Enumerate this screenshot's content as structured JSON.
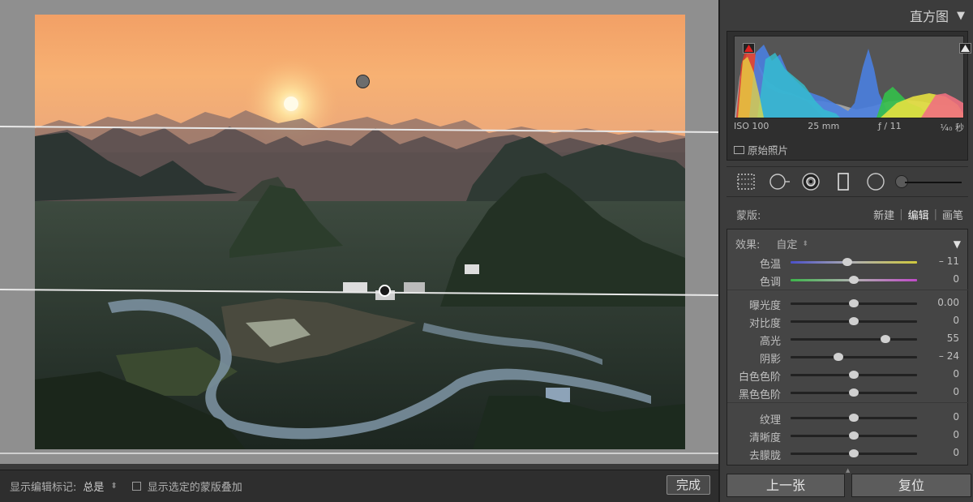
{
  "histogram": {
    "title": "直方图",
    "iso": "ISO 100",
    "focal": "25 mm",
    "aperture": "ƒ / 11",
    "shutter": "¹⁄₄₀ 秒",
    "original_photo": "原始照片"
  },
  "mask": {
    "label": "蒙版:",
    "new": "新建",
    "edit": "编辑",
    "brush": "画笔"
  },
  "effect": {
    "label": "效果:",
    "preset": "自定"
  },
  "sliders": [
    {
      "label": "色温",
      "value": "– 11",
      "position": 0.45,
      "gradient": "temp"
    },
    {
      "label": "色调",
      "value": "0",
      "position": 0.5,
      "gradient": "tint"
    },
    {
      "label": "曝光度",
      "value": "0.00",
      "position": 0.5,
      "gradient": ""
    },
    {
      "label": "对比度",
      "value": "0",
      "position": 0.5,
      "gradient": ""
    },
    {
      "label": "高光",
      "value": "55",
      "position": 0.75,
      "gradient": ""
    },
    {
      "label": "阴影",
      "value": "– 24",
      "position": 0.38,
      "gradient": ""
    },
    {
      "label": "白色色阶",
      "value": "0",
      "position": 0.5,
      "gradient": ""
    },
    {
      "label": "黑色色阶",
      "value": "0",
      "position": 0.5,
      "gradient": ""
    },
    {
      "label": "纹理",
      "value": "0",
      "position": 0.5,
      "gradient": ""
    },
    {
      "label": "清晰度",
      "value": "0",
      "position": 0.5,
      "gradient": ""
    },
    {
      "label": "去朦胧",
      "value": "0",
      "position": 0.5,
      "gradient": ""
    }
  ],
  "toolbar": {
    "show_markers_label": "显示编辑标记:",
    "show_markers_value": "总是",
    "overlay_label": "显示选定的蒙版叠加",
    "done": "完成"
  },
  "nav": {
    "prev": "上一张",
    "reset": "复位"
  },
  "colors": {
    "panel_bg": "#3c3c3c",
    "canvas_bg": "#8f8f8f"
  }
}
